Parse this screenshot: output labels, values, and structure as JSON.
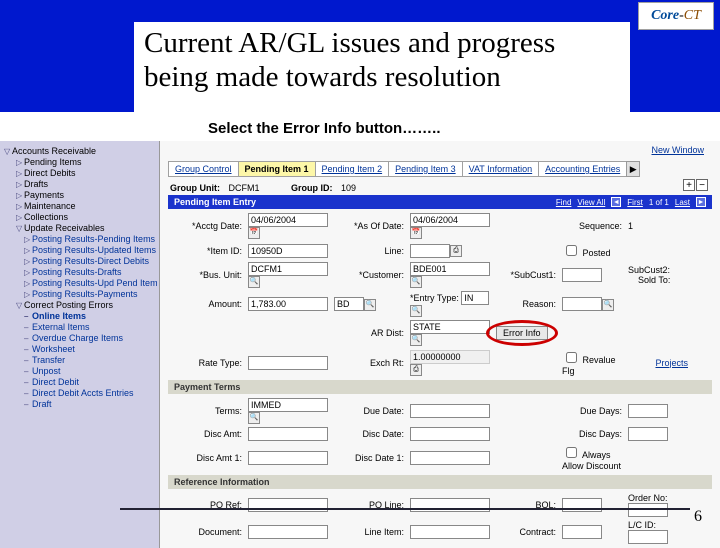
{
  "header": {
    "title": "Current AR/GL issues and progress being made towards resolution",
    "logo_core": "Core",
    "logo_dash": "-",
    "logo_ct": "CT"
  },
  "instruction": "Select the Error Info button……..",
  "sidebar": {
    "items": [
      {
        "icon": "▽",
        "label": "Accounts Receivable",
        "cls": ""
      },
      {
        "icon": "▷",
        "label": "Pending Items",
        "cls": "sub"
      },
      {
        "icon": "▷",
        "label": "Direct Debits",
        "cls": "sub"
      },
      {
        "icon": "▷",
        "label": "Drafts",
        "cls": "sub"
      },
      {
        "icon": "▷",
        "label": "Payments",
        "cls": "sub"
      },
      {
        "icon": "▷",
        "label": "Maintenance",
        "cls": "sub"
      },
      {
        "icon": "▷",
        "label": "Collections",
        "cls": "sub"
      },
      {
        "icon": "▽",
        "label": "Update Receivables",
        "cls": "sub"
      },
      {
        "icon": "▷",
        "label": "Posting Results-Pending Items",
        "cls": "sub2"
      },
      {
        "icon": "▷",
        "label": "Posting Results-Updated Items",
        "cls": "sub2"
      },
      {
        "icon": "▷",
        "label": "Posting Results-Direct Debits",
        "cls": "sub2"
      },
      {
        "icon": "▷",
        "label": "Posting Results-Drafts",
        "cls": "sub2"
      },
      {
        "icon": "▷",
        "label": "Posting Results-Upd Pend Items",
        "cls": "sub2"
      },
      {
        "icon": "▷",
        "label": "Posting Results-Payments",
        "cls": "sub2"
      },
      {
        "icon": "▽",
        "label": "Correct Posting Errors",
        "cls": "sub"
      },
      {
        "icon": "–",
        "label": "Online Items",
        "cls": "sub2 sel"
      },
      {
        "icon": "–",
        "label": "External Items",
        "cls": "sub2"
      },
      {
        "icon": "–",
        "label": "Overdue Charge Items",
        "cls": "sub2"
      },
      {
        "icon": "–",
        "label": "Worksheet",
        "cls": "sub2"
      },
      {
        "icon": "–",
        "label": "Transfer",
        "cls": "sub2"
      },
      {
        "icon": "–",
        "label": "Unpost",
        "cls": "sub2"
      },
      {
        "icon": "–",
        "label": "Direct Debit",
        "cls": "sub2"
      },
      {
        "icon": "–",
        "label": "Direct Debit Accts Entries",
        "cls": "sub2"
      },
      {
        "icon": "–",
        "label": "Draft",
        "cls": "sub2"
      }
    ]
  },
  "main": {
    "new_window": "New Window",
    "tabs": [
      "Group Control",
      "Pending Item 1",
      "Pending Item 2",
      "Pending Item 3",
      "VAT Information",
      "Accounting Entries"
    ],
    "active_tab": 1,
    "group_unit_lbl": "Group Unit:",
    "group_unit": "DCFM1",
    "group_id_lbl": "Group ID:",
    "group_id": "109",
    "bar1": "Pending Item Entry",
    "nav": {
      "find": "Find",
      "viewall": "View All",
      "first": "First",
      "range": "1 of 1",
      "last": "Last"
    },
    "plus": "+",
    "minus": "−",
    "row1": {
      "acctg_lbl": "*Acctg Date:",
      "acctg": "04/06/2004",
      "asof_lbl": "*As Of Date:",
      "asof": "04/06/2004",
      "seq_lbl": "Sequence:",
      "seq": "1"
    },
    "row2": {
      "item_lbl": "*Item ID:",
      "item": "10950D",
      "line_lbl": "Line:",
      "line": "",
      "posted_lbl": "Posted"
    },
    "row3": {
      "bus_lbl": "*Bus. Unit:",
      "bus": "DCFM1",
      "cust_lbl": "*Customer:",
      "cust": "BDE001",
      "sub1_lbl": "*SubCust1:",
      "sub1": "",
      "sub2_lbl": "SubCust2:",
      "sub2": "",
      "sold_lbl": "Sold To:"
    },
    "row4": {
      "amt_lbl": "Amount:",
      "amt": "1,783.00",
      "cur_lbl": "BD",
      "entry_lbl": "*Entry Type:",
      "entry": "IN",
      "reason_lbl": "Reason:",
      "reason": ""
    },
    "row5": {
      "ardist_lbl": "AR Dist:",
      "ardist": "STATE",
      "error_btn": "Error Info"
    },
    "row6": {
      "rate_lbl": "Rate Type:",
      "rate": "",
      "exch_lbl": "Exch Rt:",
      "exch": "1.00000000",
      "reval_lbl": "Revalue Flg",
      "proj": "Projects"
    },
    "bar2": "Payment Terms",
    "pt": {
      "terms_lbl": "Terms:",
      "terms": "IMMED",
      "due_date_lbl": "Due Date:",
      "due_days_lbl": "Due Days:",
      "disc_amt_lbl": "Disc Amt:",
      "disc_date_lbl": "Disc Date:",
      "disc_days_lbl": "Disc Days:",
      "disc_amt1_lbl": "Disc Amt 1:",
      "disc_date1_lbl": "Disc Date 1:",
      "allow_lbl": "Always Allow Discount"
    },
    "bar3": "Reference Information",
    "ref": {
      "po_lbl": "PO Ref:",
      "pol_lbl": "PO Line:",
      "bol_lbl": "BOL:",
      "order_lbl": "Order No:",
      "doc_lbl": "Document:",
      "line_lbl": "Line Item:",
      "contract_lbl": "Contract:",
      "lc_lbl": "L/C ID:"
    }
  },
  "page_number": "6"
}
